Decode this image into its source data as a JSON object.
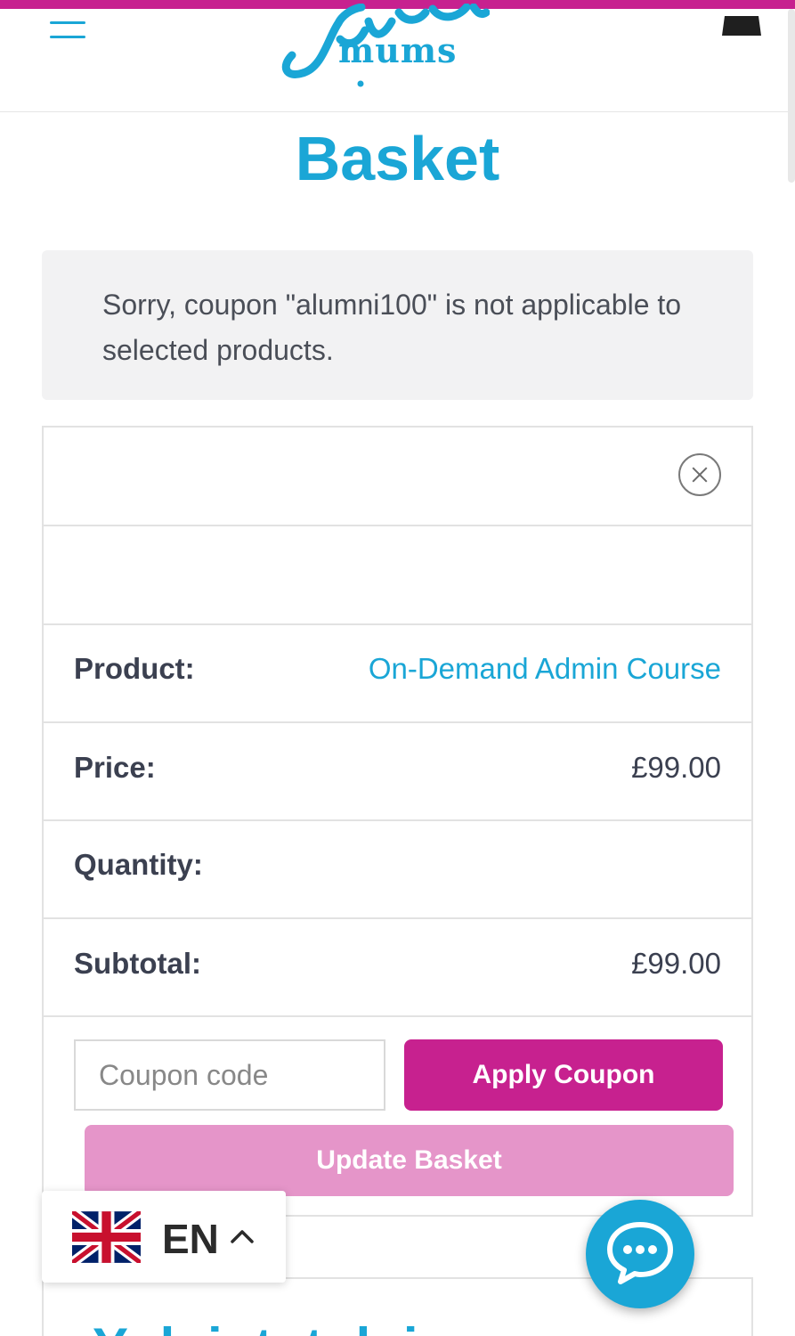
{
  "header": {
    "logo_text": "mums",
    "logo_script": "Super"
  },
  "page": {
    "title": "Basket"
  },
  "notice": {
    "message": "Sorry, coupon \"alumni100\" is not applicable to selected products."
  },
  "basket": {
    "rows": [
      {
        "label": "Product:",
        "value": "On-Demand Admin Course"
      },
      {
        "label": "Price:",
        "value": "£99.00"
      },
      {
        "label": "Quantity:",
        "value": ""
      },
      {
        "label": "Subtotal:",
        "value": "£99.00"
      }
    ],
    "coupon": {
      "placeholder": "Coupon code",
      "apply_label": "Apply Coupon"
    },
    "update_label": "Update Basket"
  },
  "language": {
    "code": "EN",
    "flag": "uk-flag-icon"
  },
  "next_section": {
    "heading_fragment": "Y        l   i  t    t  l  i"
  },
  "colors": {
    "brand_blue": "#1aa6d6",
    "brand_magenta": "#c7218f",
    "update_pink": "#e595c9"
  }
}
